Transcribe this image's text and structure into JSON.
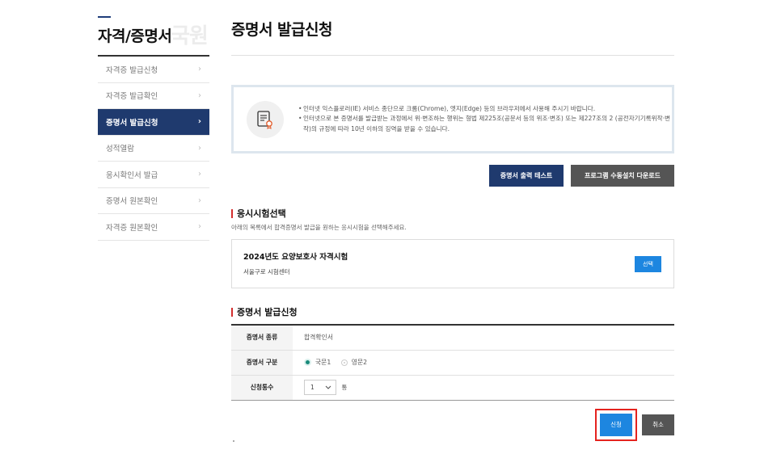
{
  "sidebar": {
    "title": "자격/증명서",
    "watermark": "국원",
    "items": [
      {
        "label": "자격증 발급신청",
        "active": false
      },
      {
        "label": "자격증 발급확인",
        "active": false
      },
      {
        "label": "증명서 발급신청",
        "active": true
      },
      {
        "label": "성적열람",
        "active": false
      },
      {
        "label": "응시확인서 발급",
        "active": false
      },
      {
        "label": "증명서 원본확인",
        "active": false
      },
      {
        "label": "자격증 원본확인",
        "active": false
      }
    ],
    "chevron": "›"
  },
  "main": {
    "page_title": "증명서 발급신청",
    "notice": {
      "icon": "document-certificate-icon",
      "lines": [
        "인터넷 익스플로러(IE) 서비스 종단으로 크롬(Chrome), 엣지(Edge) 등의 브라우저에서 사용해 주시기 바랍니다.",
        "인터넷으로 본 증명서를 발급받는 과정에서 위·변조하는 행위는 형법 제225조(공문서 등의 위조·변조) 또는 제227조의 2 (공전자기기록위작·변작)의 규정에 따라 10년 이하의 징역을 받을 수 있습니다."
      ]
    },
    "buttons": {
      "print_test": "증명서 출력 테스트",
      "manual_download": "프로그램 수동설치 다운로드"
    },
    "exam_section": {
      "heading": "응시시험선택",
      "description": "아래의 목록에서 합격증명서 발급을 원하는 응시시험을 선택해주세요.",
      "exam_name": "2024년도 요양보호사 자격시험",
      "exam_center": "서울구로 시험센터",
      "select_label": "선택"
    },
    "apply_section": {
      "heading": "증명서 발급신청",
      "rows": {
        "type_label": "증명서 종류",
        "type_value": "합격확인서",
        "category_label": "증명서 구분",
        "option1": "국문1",
        "option2": "영문2",
        "count_label": "신청통수",
        "count_value": "1",
        "count_unit": "통"
      }
    },
    "apply_button": "신청",
    "cancel_button": "취소"
  },
  "colors": {
    "navy": "#1f3a6e",
    "blue": "#1d86e0",
    "red_highlight": "#e5231f",
    "section_bar": "#d32f2f"
  }
}
